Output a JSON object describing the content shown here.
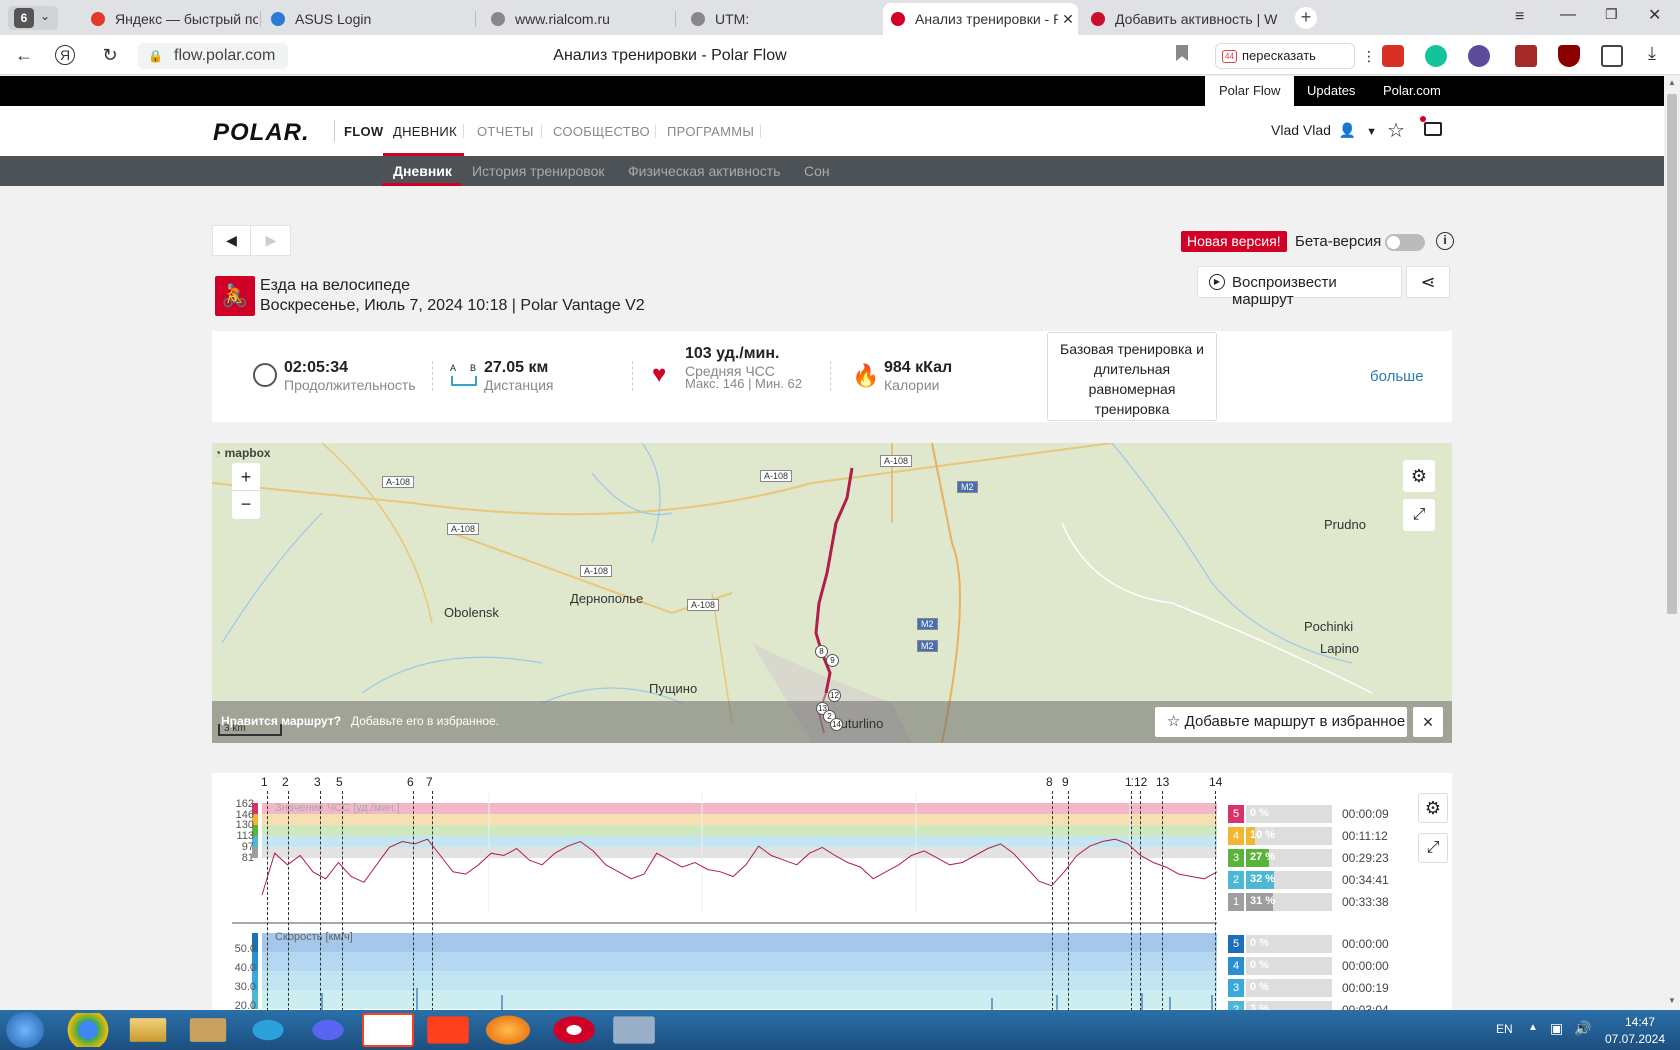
{
  "browser": {
    "tab_count": "6",
    "tabs": [
      {
        "title": "Яндекс — быстрый поиск",
        "color": "#e03b2a"
      },
      {
        "title": "ASUS Login",
        "color": "#2b7bd5"
      },
      {
        "title": "www.rialcom.ru",
        "color": "#888888"
      },
      {
        "title": "UTM:",
        "color": "#888888"
      },
      {
        "title": "Анализ тренировки - P",
        "color": "#d10027"
      },
      {
        "title": "Добавить активность | W",
        "color": "#c8102e"
      }
    ],
    "url": "flow.polar.com",
    "page_title": "Анализ тренировки - Polar Flow",
    "retell_label": "пересказать",
    "retell_badge": "44"
  },
  "polar": {
    "top_tabs": [
      "Polar Flow",
      "Updates",
      "Polar.com"
    ],
    "logo": "POLAR.",
    "flow_label": "FLOW",
    "nav": [
      "ДНЕВНИК",
      "ОТЧЕТЫ",
      "СООБЩЕСТВО",
      "ПРОГРАММЫ"
    ],
    "user": "Vlad Vlad",
    "subnav": [
      "Дневник",
      "История тренировок",
      "Физическая активность",
      "Сон"
    ],
    "new_version": "Новая версия!",
    "beta": "Бета-версия",
    "sport": "Езда на велосипеде",
    "date": "Воскресенье, Июль 7, 2024 10:18 | Polar Vantage V2",
    "replay": "Воспроизвести маршрут",
    "summary": {
      "duration": "02:05:34",
      "duration_label": "Продолжительность",
      "distance": "27.05 км",
      "distance_label": "Дистанция",
      "distance_ab": "A B",
      "hr": "103 уд./мин.",
      "hr_label": "Средняя ЧСС",
      "hr_minmax": "Макс. 146  |  Мин. 62",
      "cal": "984 кКал",
      "cal_label": "Калории",
      "benefit": "Базовая тренировка и длительная равномерная тренировка",
      "more": "больше"
    },
    "map": {
      "mapbox": "mapbox",
      "zoom_in": "+",
      "zoom_out": "−",
      "places": [
        "Obolensk",
        "Дернополье",
        "Пущино",
        "Buturlino",
        "Prudno",
        "Pochinki",
        "Lapino"
      ],
      "roads": [
        "А-108",
        "А-108",
        "А-108",
        "А-108",
        "А-108",
        "А-108",
        "М2",
        "М2",
        "М2"
      ],
      "like_q": "Нравится маршрут?",
      "like_t": "Добавьте его в избранное.",
      "fav_btn": "Добавьте маршрут в избранное",
      "scale": "3 km",
      "close": "×"
    },
    "hr_chart": {
      "label": "Значение ЧСС [уд./мин.]",
      "ticks": [
        "162",
        "146",
        "130",
        "113",
        "97",
        "81"
      ],
      "zones": [
        {
          "n": "5",
          "pct": "0 %",
          "time": "00:00:09",
          "color": "#d6336c",
          "frac": 0.0
        },
        {
          "n": "4",
          "pct": "10 %",
          "time": "00:11:12",
          "color": "#f2b632",
          "frac": 0.1
        },
        {
          "n": "3",
          "pct": "27 %",
          "time": "00:29:23",
          "color": "#5ab43c",
          "frac": 0.27
        },
        {
          "n": "2",
          "pct": "32 %",
          "time": "00:34:41",
          "color": "#4db8d6",
          "frac": 0.32
        },
        {
          "n": "1",
          "pct": "31 %",
          "time": "00:33:38",
          "color": "#9e9e9e",
          "frac": 0.31
        }
      ],
      "laps": [
        "1",
        "2",
        "3",
        "5",
        "6",
        "7",
        "8",
        "9",
        "11",
        "12",
        "13",
        "14"
      ]
    },
    "speed_chart": {
      "label": "Скорость [км/ч]",
      "ticks": [
        "50.0",
        "40.0",
        "30.0",
        "20.0"
      ],
      "zones": [
        {
          "n": "5",
          "pct": "0 %",
          "time": "00:00:00",
          "color": "#1d6fb8"
        },
        {
          "n": "4",
          "pct": "0 %",
          "time": "00:00:00",
          "color": "#2a8fd0"
        },
        {
          "n": "3",
          "pct": "0 %",
          "time": "00:00:19",
          "color": "#3aa8dc"
        },
        {
          "n": "2",
          "pct": "3 %",
          "time": "00:03:04",
          "color": "#4db8d6"
        }
      ]
    }
  },
  "taskbar": {
    "lang": "EN",
    "time": "14:47",
    "date": "07.07.2024"
  },
  "chart_data": {
    "type": "line",
    "title": "Значение ЧСС [уд./мин.]",
    "ylabel": "уд./мин.",
    "yticks": [
      162,
      146,
      130,
      113,
      97,
      81
    ],
    "series": [
      {
        "name": "Значение ЧСС [уд./мин.]",
        "values": [
          84,
          120,
          110,
          118,
          104,
          98,
          112,
          100,
          95,
          110,
          125,
          130,
          128,
          132,
          118,
          104,
          102,
          110,
          120,
          118,
          124,
          114,
          110,
          120,
          126,
          130,
          122,
          110,
          104,
          98,
          102,
          120,
          114,
          108,
          112,
          106,
          104,
          100,
          110,
          126,
          118,
          114,
          110,
          120,
          125,
          118,
          112,
          108,
          98,
          104,
          110,
          118,
          122,
          116,
          110,
          112,
          118,
          124,
          128,
          120,
          108,
          96,
          92,
          104,
          118,
          126,
          130,
          132,
          128,
          118,
          112,
          108,
          102,
          100,
          98,
          104
        ]
      }
    ]
  }
}
